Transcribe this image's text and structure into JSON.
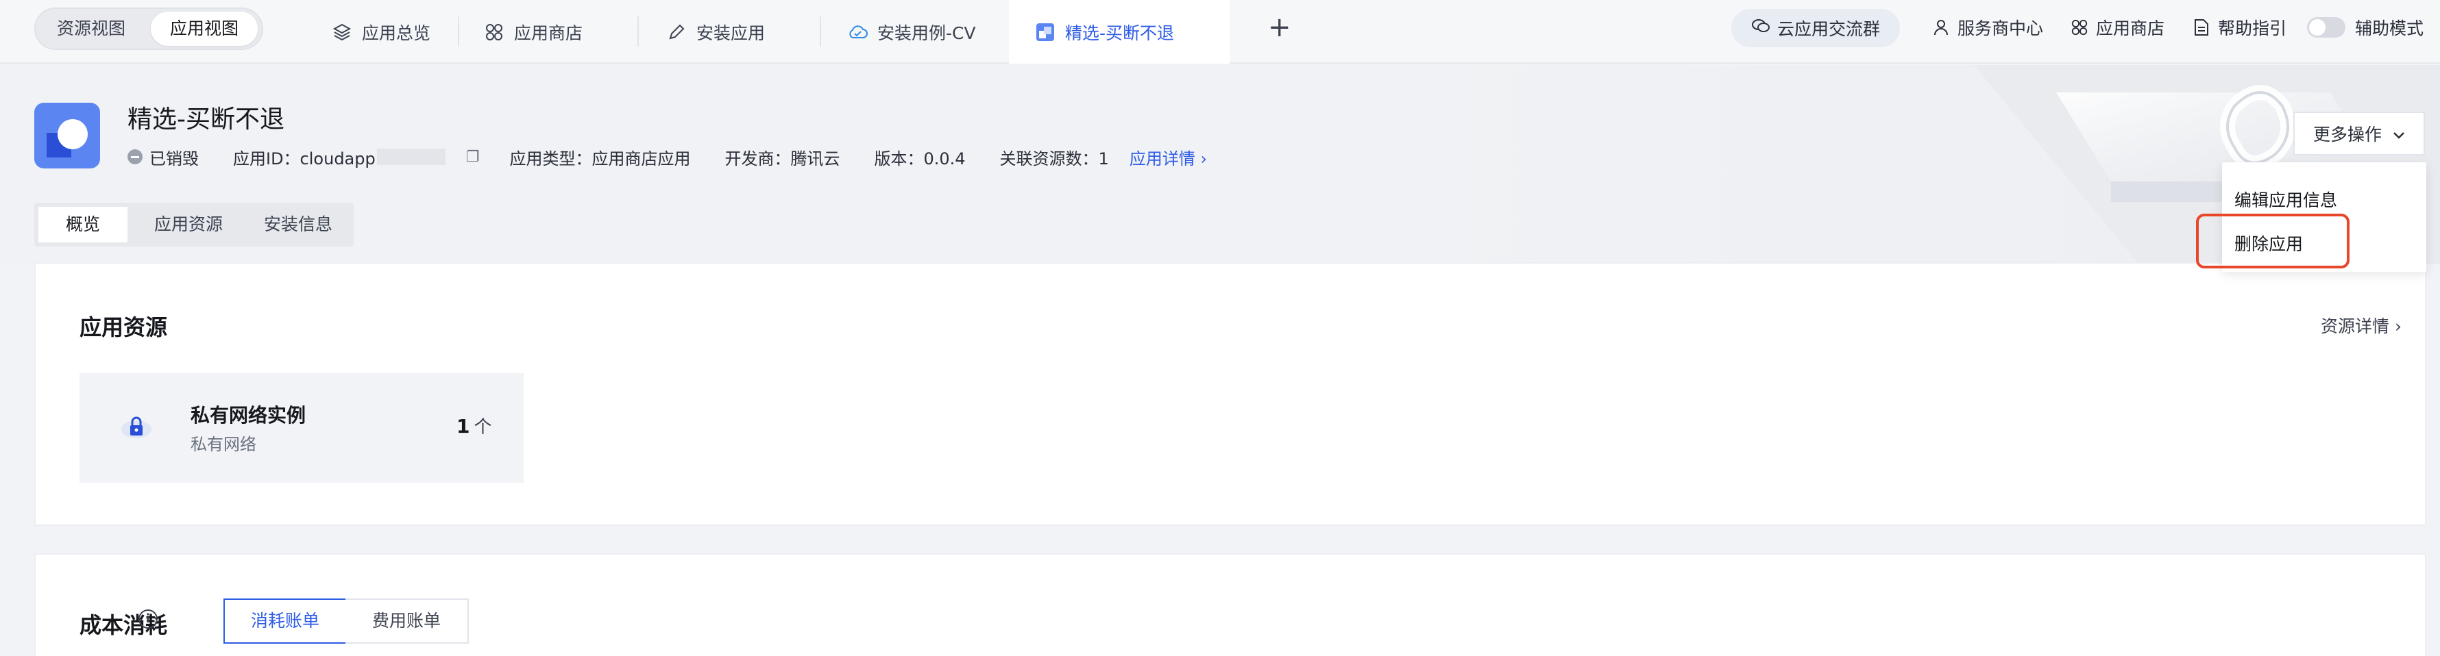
{
  "topbar": {
    "view_switch": {
      "resource_view": "资源视图",
      "app_view": "应用视图"
    },
    "tabs": [
      {
        "label": "应用总览",
        "icon": "layers-icon"
      },
      {
        "label": "应用商店",
        "icon": "grid-icon"
      },
      {
        "label": "安装应用",
        "icon": "pencil-icon"
      },
      {
        "label": "安装用例-CV",
        "icon": "cloud-icon"
      },
      {
        "label": "精选-买断不退",
        "icon": "app-icon",
        "active": true
      }
    ],
    "add_tab": "+",
    "right": {
      "community": "云应用交流群",
      "service_center": "服务商中心",
      "store": "应用商店",
      "help": "帮助指引",
      "assist_mode": "辅助模式"
    }
  },
  "app": {
    "title": "精选-买断不退",
    "status": "已销毁",
    "app_id_label": "应用ID：cloudapp",
    "app_type": "应用类型：应用商店应用",
    "developer": "开发商：腾讯云",
    "version": "版本：0.0.4",
    "resource_count": "关联资源数：1",
    "details_link": "应用详情 ›"
  },
  "subtabs": [
    "概览",
    "应用资源",
    "安装信息"
  ],
  "actions": {
    "more_label": "更多操作",
    "menu": [
      "编辑应用信息",
      "删除应用"
    ]
  },
  "resources": {
    "title": "应用资源",
    "details_link": "资源详情 ›",
    "item": {
      "name": "私有网络实例",
      "sub": "私有网络",
      "count": "1",
      "unit": "个"
    }
  },
  "cost": {
    "title": "成本消耗",
    "segments": [
      "消耗账单",
      "费用账单"
    ]
  },
  "colors": {
    "accent": "#2e5ce6",
    "highlight": "#e8472a"
  }
}
